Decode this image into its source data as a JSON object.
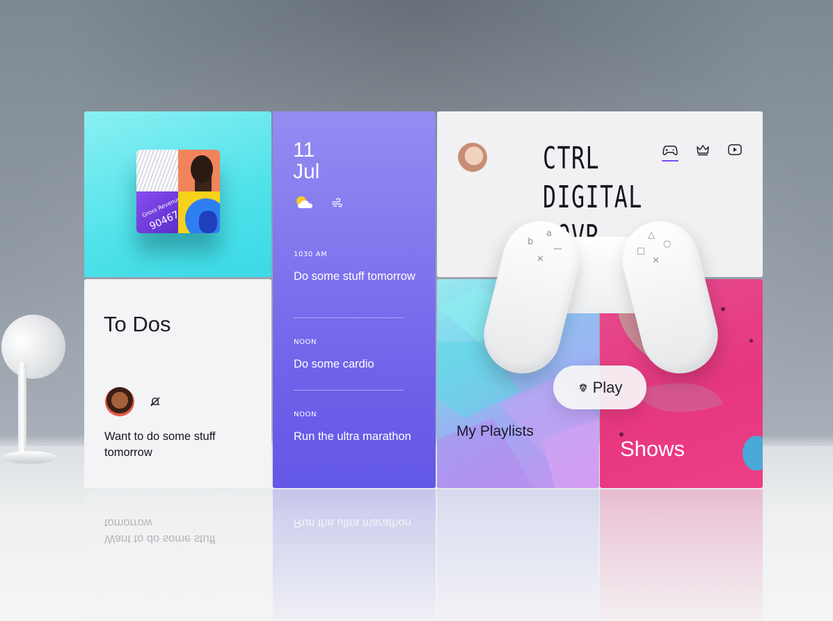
{
  "album": {
    "revenue_label": "Gross Revenue",
    "revenue_value": "90467"
  },
  "todo": {
    "title": "To Dos",
    "item_text": "Want to do some stuff tomorrow"
  },
  "calendar": {
    "day": "11",
    "month": "Jul",
    "events": [
      {
        "time": "1030 AM",
        "title": "Do some stuff tomorrow"
      },
      {
        "time": "NOON",
        "title": "Do some cardio"
      },
      {
        "time": "NOON",
        "title": "Run the ultra marathon"
      }
    ]
  },
  "brand": {
    "line1": "CTRL",
    "line2": "DIGITAL",
    "line3": "LOVR"
  },
  "nav": {
    "icons": [
      "gamepad-icon",
      "crown-icon",
      "video-play-icon"
    ],
    "active_index": 0,
    "accent": "#7a4cf0"
  },
  "playlists": {
    "label": "My Playlists"
  },
  "shows": {
    "label": "Shows"
  },
  "play_button": {
    "label": "Play",
    "icon": "fingerprint-icon"
  },
  "colors": {
    "cyan_tile": "#4fe2ea",
    "calendar_tile": "#6f63ea",
    "shows_tile": "#e6377f"
  }
}
